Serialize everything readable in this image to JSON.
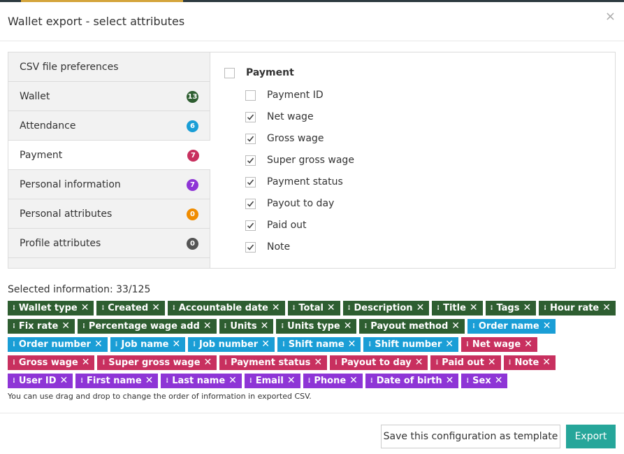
{
  "modal": {
    "title": "Wallet export - select attributes",
    "close_symbol": "×"
  },
  "sidebar": {
    "items": [
      {
        "label": "CSV file preferences",
        "count": null,
        "color": null,
        "active": false
      },
      {
        "label": "Wallet",
        "count": "13",
        "color": "#2e5e31",
        "active": false
      },
      {
        "label": "Attendance",
        "count": "6",
        "color": "#1a9ed6",
        "active": false
      },
      {
        "label": "Payment",
        "count": "7",
        "color": "#c8305f",
        "active": true
      },
      {
        "label": "Personal information",
        "count": "7",
        "color": "#8e35d6",
        "active": false
      },
      {
        "label": "Personal attributes",
        "count": "0",
        "color": "#f08c00",
        "active": false
      },
      {
        "label": "Profile attributes",
        "count": "0",
        "color": "#555555",
        "active": false
      }
    ]
  },
  "payment_group": {
    "label": "Payment",
    "checked": false,
    "options": [
      {
        "label": "Payment ID",
        "checked": false
      },
      {
        "label": "Net wage",
        "checked": true
      },
      {
        "label": "Gross wage",
        "checked": true
      },
      {
        "label": "Super gross wage",
        "checked": true
      },
      {
        "label": "Payment status",
        "checked": true
      },
      {
        "label": "Payout to day",
        "checked": true
      },
      {
        "label": "Paid out",
        "checked": true
      },
      {
        "label": "Note",
        "checked": true
      }
    ]
  },
  "selected": {
    "info": "Selected information: 33/125",
    "hint": "You can use drag and drop to change the order of information in exported CSV.",
    "colors": {
      "wallet": "#2e5e31",
      "attendance": "#1a9ed6",
      "payment": "#c8305f",
      "personal": "#8e35d6"
    },
    "tags": [
      {
        "label": "Wallet type",
        "cat": "wallet"
      },
      {
        "label": "Created",
        "cat": "wallet"
      },
      {
        "label": "Accountable date",
        "cat": "wallet"
      },
      {
        "label": "Total",
        "cat": "wallet"
      },
      {
        "label": "Description",
        "cat": "wallet"
      },
      {
        "label": "Title",
        "cat": "wallet"
      },
      {
        "label": "Tags",
        "cat": "wallet"
      },
      {
        "label": "Hour rate",
        "cat": "wallet"
      },
      {
        "label": "Fix rate",
        "cat": "wallet"
      },
      {
        "label": "Percentage wage add",
        "cat": "wallet"
      },
      {
        "label": "Units",
        "cat": "wallet"
      },
      {
        "label": "Units type",
        "cat": "wallet"
      },
      {
        "label": "Payout method",
        "cat": "wallet"
      },
      {
        "label": "Order name",
        "cat": "attendance"
      },
      {
        "label": "Order number",
        "cat": "attendance"
      },
      {
        "label": "Job name",
        "cat": "attendance"
      },
      {
        "label": "Job number",
        "cat": "attendance"
      },
      {
        "label": "Shift name",
        "cat": "attendance"
      },
      {
        "label": "Shift number",
        "cat": "attendance"
      },
      {
        "label": "Net wage",
        "cat": "payment"
      },
      {
        "label": "Gross wage",
        "cat": "payment"
      },
      {
        "label": "Super gross wage",
        "cat": "payment"
      },
      {
        "label": "Payment status",
        "cat": "payment"
      },
      {
        "label": "Payout to day",
        "cat": "payment"
      },
      {
        "label": "Paid out",
        "cat": "payment"
      },
      {
        "label": "Note",
        "cat": "payment"
      },
      {
        "label": "User ID",
        "cat": "personal"
      },
      {
        "label": "First name",
        "cat": "personal"
      },
      {
        "label": "Last name",
        "cat": "personal"
      },
      {
        "label": "Email",
        "cat": "personal"
      },
      {
        "label": "Phone",
        "cat": "personal"
      },
      {
        "label": "Date of birth",
        "cat": "personal"
      },
      {
        "label": "Sex",
        "cat": "personal"
      }
    ]
  },
  "footer": {
    "save_template_label": "Save this configuration as template",
    "export_label": "Export"
  }
}
